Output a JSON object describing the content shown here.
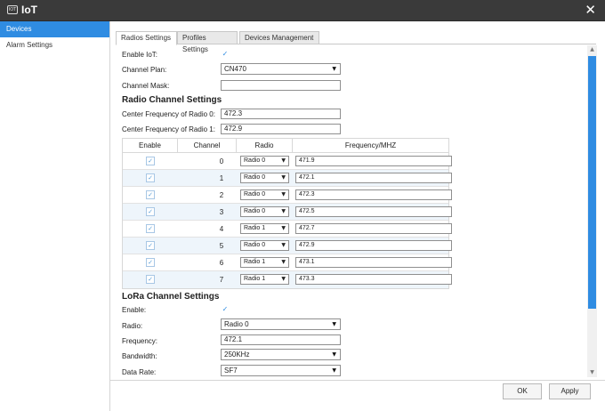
{
  "window": {
    "logo_text": "IOT",
    "title": "IoT",
    "close_glyph": "✕"
  },
  "sidebar": {
    "items": [
      {
        "label": "Devices"
      },
      {
        "label": "Alarm Settings"
      }
    ]
  },
  "tabs": [
    {
      "label": "Radios Settings"
    },
    {
      "label": "Profiles Settings"
    },
    {
      "label": "Devices Management"
    }
  ],
  "form": {
    "enable_iot_label": "Enable IoT:",
    "channel_plan_label": "Channel Plan:",
    "channel_plan_value": "CN470",
    "channel_mask_label": "Channel Mask:",
    "channel_mask_value": "",
    "radio_section_title": "Radio Channel Settings",
    "center_freq_0_label": "Center Frequency of Radio 0:",
    "center_freq_0_value": "472.3",
    "center_freq_1_label": "Center Frequency of Radio 1:",
    "center_freq_1_value": "472.9"
  },
  "channel_table": {
    "headers": {
      "enable": "Enable",
      "channel": "Channel",
      "radio": "Radio",
      "frequency": "Frequency/MHZ"
    },
    "rows": [
      {
        "enabled": true,
        "channel": "0",
        "radio": "Radio 0",
        "frequency": "471.9"
      },
      {
        "enabled": true,
        "channel": "1",
        "radio": "Radio 0",
        "frequency": "472.1"
      },
      {
        "enabled": true,
        "channel": "2",
        "radio": "Radio 0",
        "frequency": "472.3"
      },
      {
        "enabled": true,
        "channel": "3",
        "radio": "Radio 0",
        "frequency": "472.5"
      },
      {
        "enabled": true,
        "channel": "4",
        "radio": "Radio 1",
        "frequency": "472.7"
      },
      {
        "enabled": true,
        "channel": "5",
        "radio": "Radio 0",
        "frequency": "472.9"
      },
      {
        "enabled": true,
        "channel": "6",
        "radio": "Radio 1",
        "frequency": "473.1"
      },
      {
        "enabled": true,
        "channel": "7",
        "radio": "Radio 1",
        "frequency": "473.3"
      }
    ]
  },
  "lora": {
    "section_title": "LoRa Channel Settings",
    "enable_label": "Enable:",
    "radio_label": "Radio:",
    "radio_value": "Radio 0",
    "frequency_label": "Frequency:",
    "frequency_value": "472.1",
    "bandwidth_label": "Bandwidth:",
    "bandwidth_value": "250KHz",
    "data_rate_label": "Data Rate:",
    "data_rate_value": "SF7"
  },
  "buttons": {
    "ok": "OK",
    "apply": "Apply"
  },
  "glyphs": {
    "check": "✓",
    "caret": "▼",
    "scroll_up": "▲",
    "scroll_down": "▼"
  },
  "colors": {
    "accent": "#2f8ce2",
    "titlebar": "#3a3a3a",
    "row_alt": "#eef5fb"
  }
}
